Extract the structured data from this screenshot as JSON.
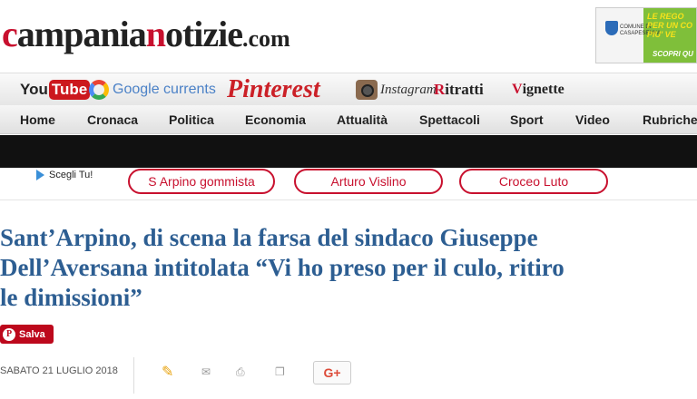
{
  "header": {
    "logo": {
      "part1": "c",
      "part2": "ampania",
      "part3": "n",
      "part4": "otizie",
      "part5": ".com"
    },
    "banner": {
      "line1": "LE REGO",
      "line2": "PER UN CO",
      "line3": "PIU' VE",
      "cta": "SCOPRI QU",
      "comune": "COMUNE DI CASAPESENNA"
    }
  },
  "social": {
    "youtube_a": "You",
    "youtube_b": "Tube",
    "google": "Google currents",
    "pinterest": "Pinterest",
    "instagram": "Instagram",
    "ritratti_cap": "R",
    "ritratti_rest": "itratti",
    "vignette_cap": "V",
    "vignette_rest": "ignette"
  },
  "nav": {
    "items": [
      "Home",
      "Cronaca",
      "Politica",
      "Economia",
      "Attualità",
      "Spettacoli",
      "Sport",
      "Video",
      "Rubriche"
    ]
  },
  "promo": {
    "scegli": "Scegli Tu!",
    "pills": [
      "S Arpino gommista",
      "Arturo Vislino",
      "Croceo Luto"
    ]
  },
  "article": {
    "headline_l1": "Sant’Arpino, di scena la farsa del sindaco Giuseppe",
    "headline_l2": "Dell’Aversana intitolata “Vi ho preso per il culo, ritiro",
    "headline_l3": "le dimissioni”",
    "salva": "Salva",
    "salva_p": "P",
    "date": "SABATO 21 LUGLIO 2018",
    "gplus": "G+"
  },
  "colors": {
    "brand_red": "#c8102e",
    "headline_blue": "#2d5e92",
    "pinterest_red": "#bd081c"
  }
}
